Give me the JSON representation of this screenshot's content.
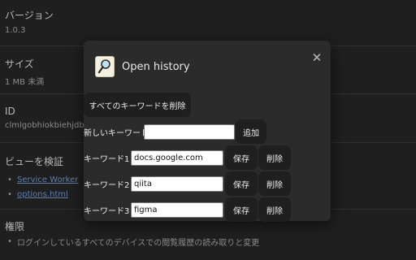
{
  "background": {
    "version": {
      "title": "バージョン",
      "value": "1.0.3"
    },
    "size": {
      "title": "サイズ",
      "value": "1 MB 未満"
    },
    "id": {
      "title": "ID",
      "value": "clmlgobhiokbiehjdbf"
    },
    "inspect_views": {
      "title": "ビューを検証",
      "links": [
        "Service Worker",
        "options.html"
      ]
    },
    "permissions": {
      "title": "権限",
      "items": [
        "ログインしているすべてのデバイスでの閲覧履歴の読み取りと変更"
      ]
    }
  },
  "dialog": {
    "title": "Open history",
    "logo_icon": "magnifier-icon",
    "close_icon": "close-icon"
  },
  "popup": {
    "delete_all_label": "すべてのキーワードを削除",
    "new_keyword": {
      "label": "新しいキーワード",
      "value": "",
      "add_label": "追加"
    },
    "keywords": [
      {
        "label": "キーワード1：",
        "value": "docs.google.com",
        "save_label": "保存",
        "delete_label": "削除"
      },
      {
        "label": "キーワード2：",
        "value": "qiita",
        "save_label": "保存",
        "delete_label": "削除"
      },
      {
        "label": "キーワード3：",
        "value": "figma",
        "save_label": "保存",
        "delete_label": "削除"
      }
    ]
  },
  "colors": {
    "page_background": "#1f1f1f",
    "dialog_background": "#2b2b2b",
    "button_background": "#1f1f1f",
    "link": "#5f7fb0"
  }
}
